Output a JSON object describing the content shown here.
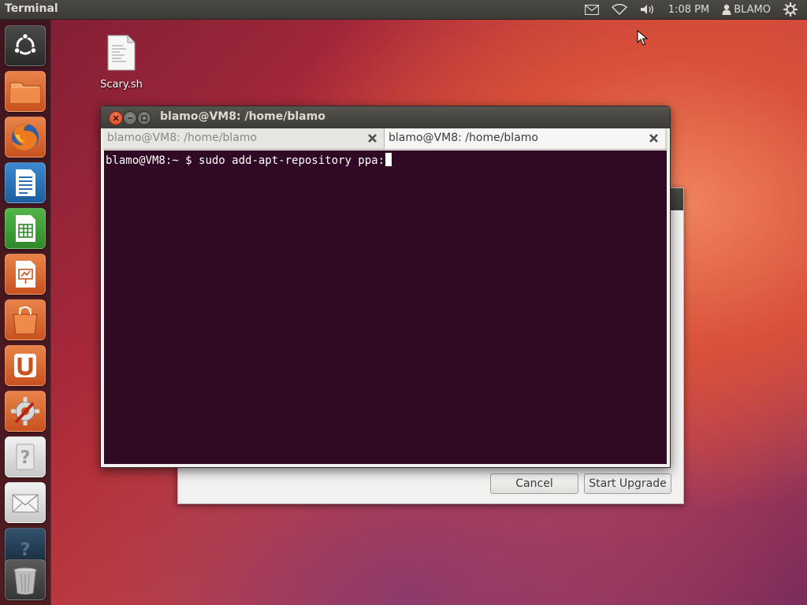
{
  "top_panel": {
    "app_name": "Terminal",
    "clock": "1:08 PM",
    "user": "BLAMO",
    "icons": [
      "mail-icon",
      "wifi-icon",
      "volume-icon",
      "user-icon",
      "gear-icon"
    ]
  },
  "launcher": {
    "items": [
      {
        "name": "dash-home",
        "icon": "ubuntu-logo-icon"
      },
      {
        "name": "home-folder",
        "icon": "folder-icon"
      },
      {
        "name": "firefox",
        "icon": "firefox-icon"
      },
      {
        "name": "libreoffice-writer",
        "icon": "writer-icon"
      },
      {
        "name": "libreoffice-calc",
        "icon": "calc-icon"
      },
      {
        "name": "libreoffice-impress",
        "icon": "impress-icon"
      },
      {
        "name": "ubuntu-software-center",
        "icon": "shopping-bag-icon"
      },
      {
        "name": "ubuntu-one",
        "icon": "ubuntu-one-icon"
      },
      {
        "name": "system-settings",
        "icon": "settings-icon"
      },
      {
        "name": "help",
        "icon": "question-icon"
      },
      {
        "name": "update-manager",
        "icon": "envelope-icon"
      },
      {
        "name": "help-dark",
        "icon": "question-dark-icon"
      },
      {
        "name": "trash",
        "icon": "trash-icon"
      }
    ]
  },
  "desktop": {
    "file_label": "Scary.sh"
  },
  "terminal": {
    "window_title": "blamo@VM8: /home/blamo",
    "tabs": [
      {
        "label": "blamo@VM8: /home/blamo",
        "active": false
      },
      {
        "label": "blamo@VM8: /home/blamo",
        "active": true
      }
    ],
    "prompt": "blamo@VM8:~ $ ",
    "command": "sudo add-apt-repository ppa:"
  },
  "dialog": {
    "cancel_label": "Cancel",
    "upgrade_label": "Start Upgrade"
  },
  "colors": {
    "terminal_bg": "#300a24",
    "panel_bg": "#3c3b37",
    "close_button": "#d8451d"
  }
}
